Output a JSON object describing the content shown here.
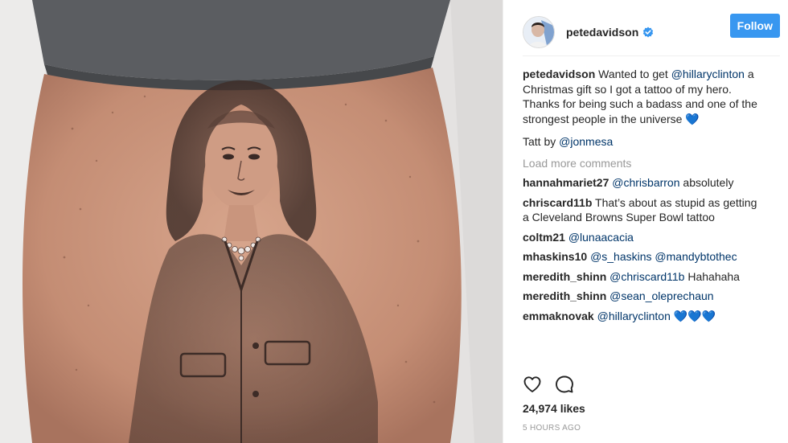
{
  "post": {
    "username": "petedavidson",
    "follow_label": "Follow",
    "caption": {
      "user": "petedavidson",
      "t1": " Wanted to get ",
      "m1": "@hillaryclinton",
      "t2": " a Christmas gift so I got a tattoo of my hero. Thanks for being such a badass and one of the strongest people in the universe ",
      "emoji": "💙"
    },
    "credit": {
      "text": "Tatt by ",
      "mention": "@jonmesa"
    },
    "load_more": "Load more comments",
    "comments": [
      {
        "user": "hannahmariet27",
        "mention": "@chrisbarron",
        "text": " absolutely"
      },
      {
        "user": "chriscard11b",
        "mention": "",
        "text": "That’s about as stupid as getting a Cleveland Browns Super Bowl tattoo"
      },
      {
        "user": "coltm21",
        "mention": "@lunaacacia",
        "text": ""
      },
      {
        "user": "mhaskins10",
        "mention": "@s_haskins @mandybtothec",
        "text": ""
      },
      {
        "user": "meredith_shinn",
        "mention": "@chriscard11b",
        "text": " Hahahaha"
      },
      {
        "user": "meredith_shinn",
        "mention": "@sean_oleprechaun",
        "text": ""
      },
      {
        "user": "emmaknovak",
        "mention": "@hillaryclinton",
        "text": " 💙💙💙"
      }
    ],
    "likes": "24,974 likes",
    "time": "5 HOURS AGO"
  },
  "icons": {
    "verified": "verified-badge-icon",
    "like": "heart-outline-icon",
    "comment": "speech-bubble-icon"
  },
  "colors": {
    "follow_button": "#3897f0",
    "mention": "#003569",
    "muted": "#999999",
    "text": "#262626"
  }
}
